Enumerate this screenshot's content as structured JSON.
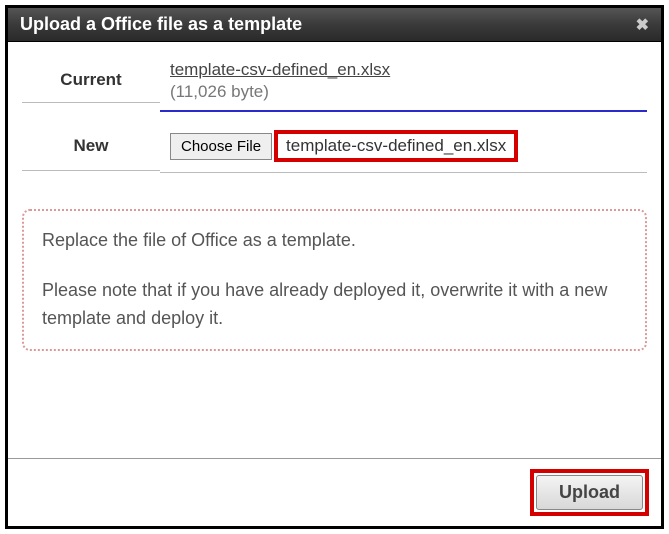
{
  "dialog": {
    "title": "Upload a Office file as a template",
    "close": "✖"
  },
  "current": {
    "label": "Current",
    "filename": "template-csv-defined_en.xlsx",
    "filesize": "(11,026 byte)"
  },
  "new": {
    "label": "New",
    "choose_button": "Choose File",
    "chosen_filename": "template-csv-defined_en.xlsx"
  },
  "info": {
    "line1": "Replace the file of Office as a template.",
    "line2": "Please note that if you have already deployed it, overwrite it with a new template and deploy it."
  },
  "footer": {
    "upload_button": "Upload"
  }
}
